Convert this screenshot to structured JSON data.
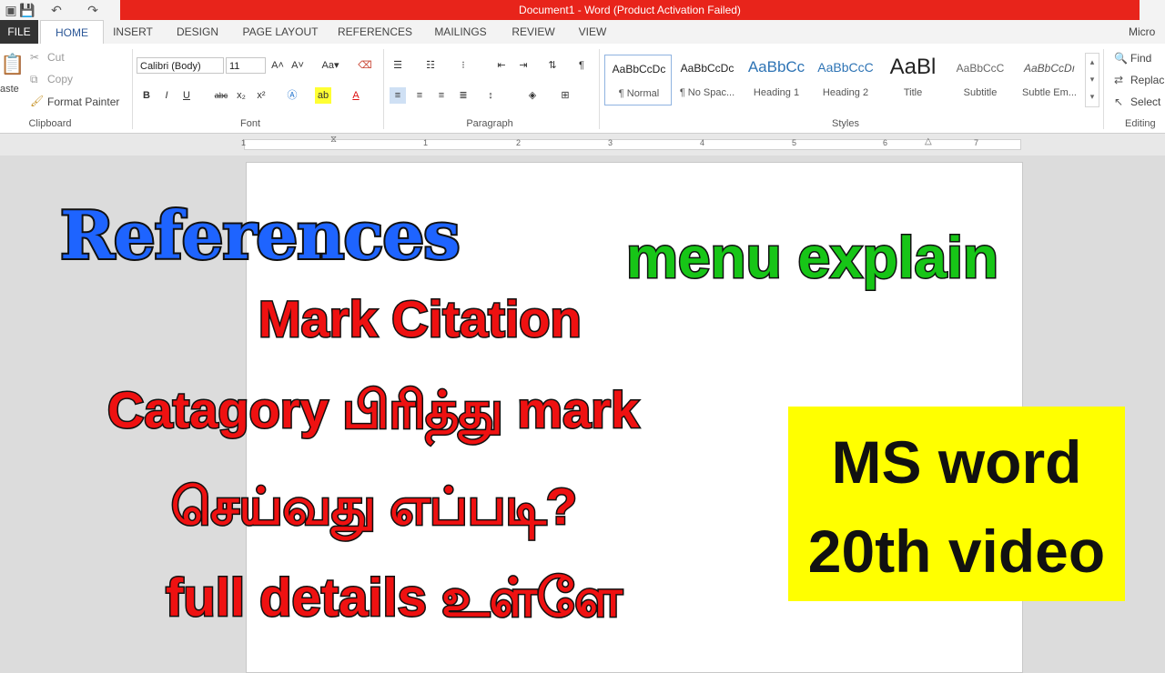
{
  "window": {
    "title": "Document1 - Word (Product Activation Failed)"
  },
  "tabs": [
    {
      "label": "FILE"
    },
    {
      "label": "HOME"
    },
    {
      "label": "INSERT"
    },
    {
      "label": "DESIGN"
    },
    {
      "label": "PAGE LAYOUT"
    },
    {
      "label": "REFERENCES"
    },
    {
      "label": "MAILINGS"
    },
    {
      "label": "REVIEW"
    },
    {
      "label": "VIEW"
    },
    {
      "label": "Micro"
    }
  ],
  "clipboard": {
    "paste_label": "aste",
    "cut_label": "Cut",
    "copy_label": "Copy",
    "format_painter_label": "Format Painter",
    "group_label": "Clipboard"
  },
  "font": {
    "font_name": "Calibri (Body)",
    "font_size": "11",
    "group_label": "Font"
  },
  "paragraph": {
    "group_label": "Paragraph"
  },
  "styles": {
    "group_label": "Styles",
    "items": [
      {
        "sample": "AaBbCcDc",
        "name": "¶ Normal"
      },
      {
        "sample": "AaBbCcDc",
        "name": "¶ No Spac..."
      },
      {
        "sample": "AaBbCc",
        "name": "Heading 1"
      },
      {
        "sample": "AaBbCcC",
        "name": "Heading 2"
      },
      {
        "sample": "AaBl",
        "name": "Title"
      },
      {
        "sample": "AaBbCcC",
        "name": "Subtitle"
      },
      {
        "sample": "AaBbCcDı",
        "name": "Subtle Em..."
      }
    ]
  },
  "editing": {
    "find_label": "Find",
    "replace_label": "Replac",
    "select_label": "Select",
    "group_label": "Editing"
  },
  "ruler": {
    "numbers": [
      "1",
      "1",
      "2",
      "3",
      "4",
      "5",
      "6",
      "7"
    ]
  },
  "overlay": {
    "headline": "References",
    "headline_suffix": "menu explain",
    "line1": "Mark Citation",
    "line2": "Catagory பிரித்து mark",
    "line3": "செய்வது எப்படி?",
    "line4": "full details உள்ளே",
    "badge_line1": "MS word",
    "badge_line2": "20th video"
  },
  "colors": {
    "title_bar_red": "#e8241b",
    "headline_blue": "#1e64ff",
    "suffix_green": "#17c517",
    "body_red": "#ef1111",
    "badge_yellow": "#ffff00"
  }
}
